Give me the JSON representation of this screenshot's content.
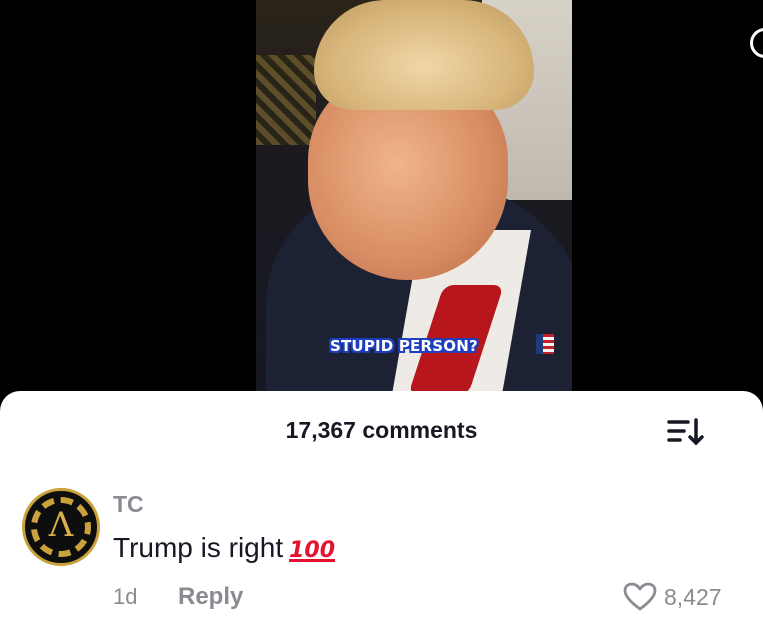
{
  "video": {
    "caption": "STUPID PERSON?"
  },
  "comments_sheet": {
    "title": "17,367 comments",
    "sort_icon": "sort-down-icon"
  },
  "comment": {
    "username": "TC",
    "text": "Trump is right",
    "emoji": "100",
    "time": "1d",
    "reply_label": "Reply",
    "likes": "8,427",
    "like_icon": "heart-outline-icon",
    "avatar_glyph": "Λ"
  },
  "colors": {
    "caption_outline": "#1c3fbf",
    "primary_text": "#161823",
    "secondary_text": "#8a8b91",
    "emoji_red": "#e4112f",
    "avatar_gold": "#c9a23c"
  }
}
